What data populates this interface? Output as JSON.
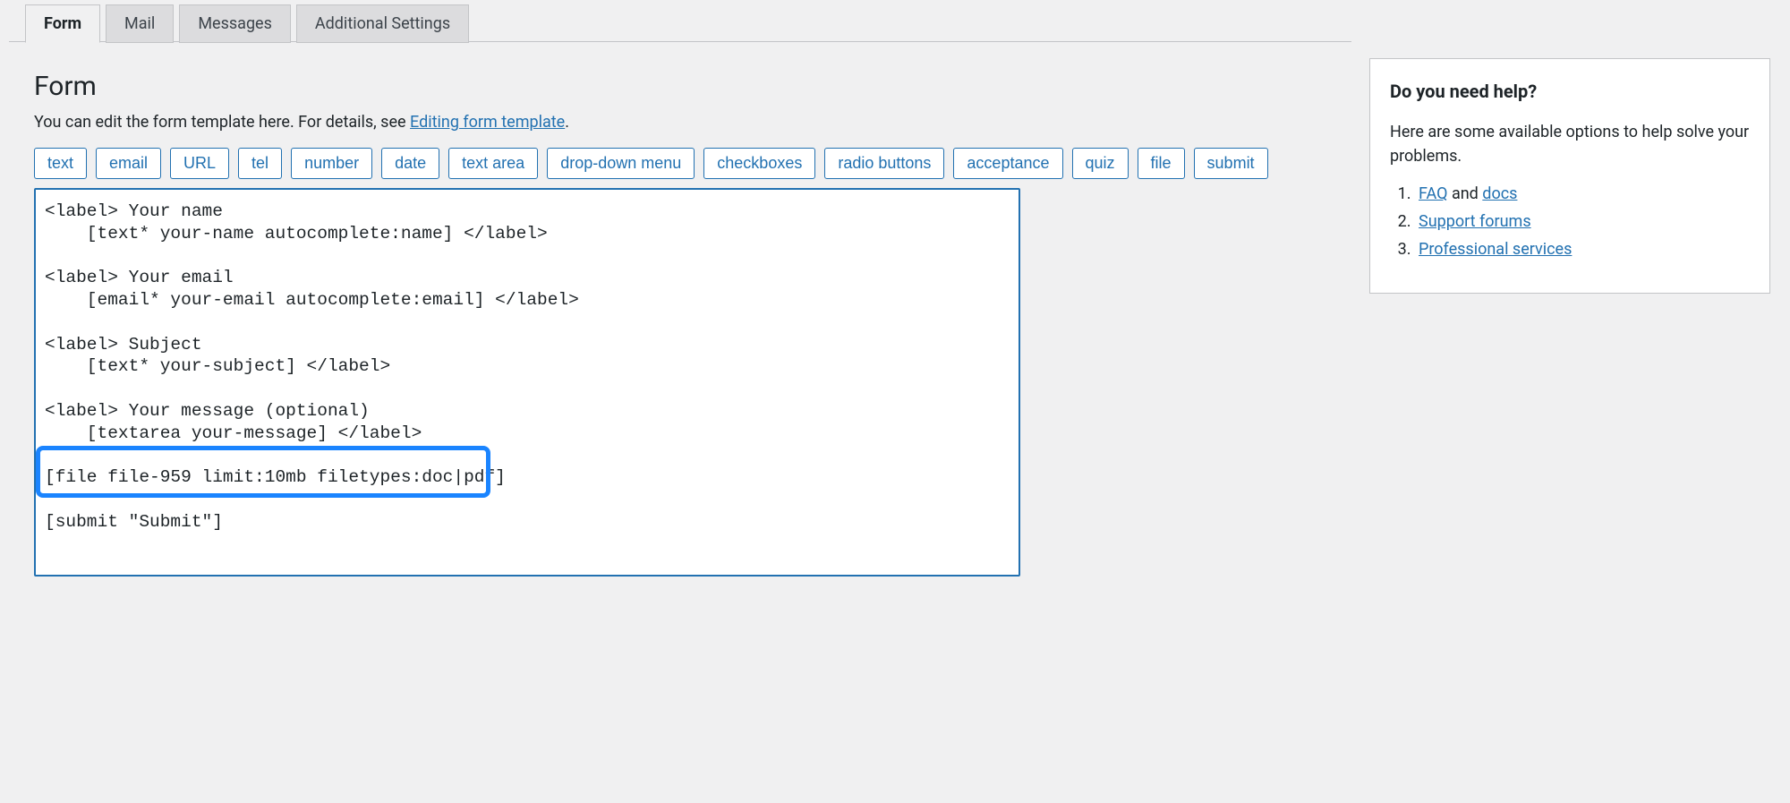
{
  "tabs": {
    "form": "Form",
    "mail": "Mail",
    "messages": "Messages",
    "additional": "Additional Settings"
  },
  "main": {
    "heading": "Form",
    "intro_prefix": "You can edit the form template here. For details, see ",
    "intro_link": "Editing form template",
    "intro_suffix": ".",
    "tag_buttons": [
      "text",
      "email",
      "URL",
      "tel",
      "number",
      "date",
      "text area",
      "drop-down menu",
      "checkboxes",
      "radio buttons",
      "acceptance",
      "quiz",
      "file",
      "submit"
    ],
    "editor_value": "<label> Your name\n    [text* your-name autocomplete:name] </label>\n\n<label> Your email\n    [email* your-email autocomplete:email] </label>\n\n<label> Subject\n    [text* your-subject] </label>\n\n<label> Your message (optional)\n    [textarea your-message] </label>\n\n[file file-959 limit:10mb filetypes:doc|pdf]\n\n[submit \"Submit\"]"
  },
  "sidebar": {
    "title": "Do you need help?",
    "intro": "Here are some available options to help solve your problems.",
    "item1_link": "FAQ",
    "item1_mid": " and ",
    "item1_link2": "docs",
    "item2": "Support forums",
    "item3": "Professional services"
  }
}
